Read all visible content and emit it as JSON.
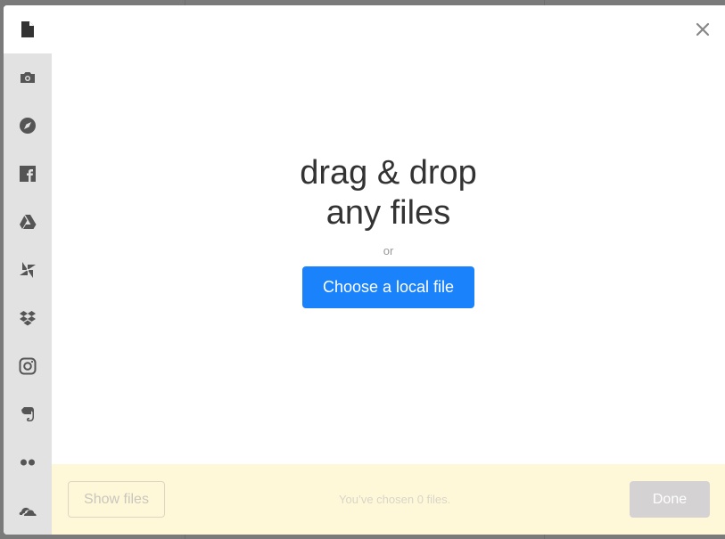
{
  "dialog": {
    "main": {
      "title_line1": "drag & drop",
      "title_line2": "any files",
      "or_label": "or",
      "choose_button": "Choose a local file"
    },
    "sidebar": {
      "active_source": "my-device",
      "items": [
        {
          "name": "my-device",
          "icon": "file-icon"
        },
        {
          "name": "webcam",
          "icon": "camera-icon"
        },
        {
          "name": "url",
          "icon": "compass-icon"
        },
        {
          "name": "facebook",
          "icon": "facebook-icon"
        },
        {
          "name": "google-drive",
          "icon": "google-drive-icon"
        },
        {
          "name": "google-photos",
          "icon": "pinwheel-icon"
        },
        {
          "name": "dropbox",
          "icon": "dropbox-icon"
        },
        {
          "name": "instagram",
          "icon": "instagram-icon"
        },
        {
          "name": "evernote",
          "icon": "evernote-icon"
        },
        {
          "name": "flickr",
          "icon": "flickr-icon"
        },
        {
          "name": "onedrive",
          "icon": "onedrive-icon"
        }
      ]
    },
    "footer": {
      "show_files_label": "Show files",
      "chosen_text": "You’ve chosen 0 files.",
      "done_label": "Done"
    },
    "colors": {
      "accent": "#1a82fb",
      "footer_bg": "#fff8d8",
      "sidebar_bg": "#e3e2e3"
    }
  }
}
